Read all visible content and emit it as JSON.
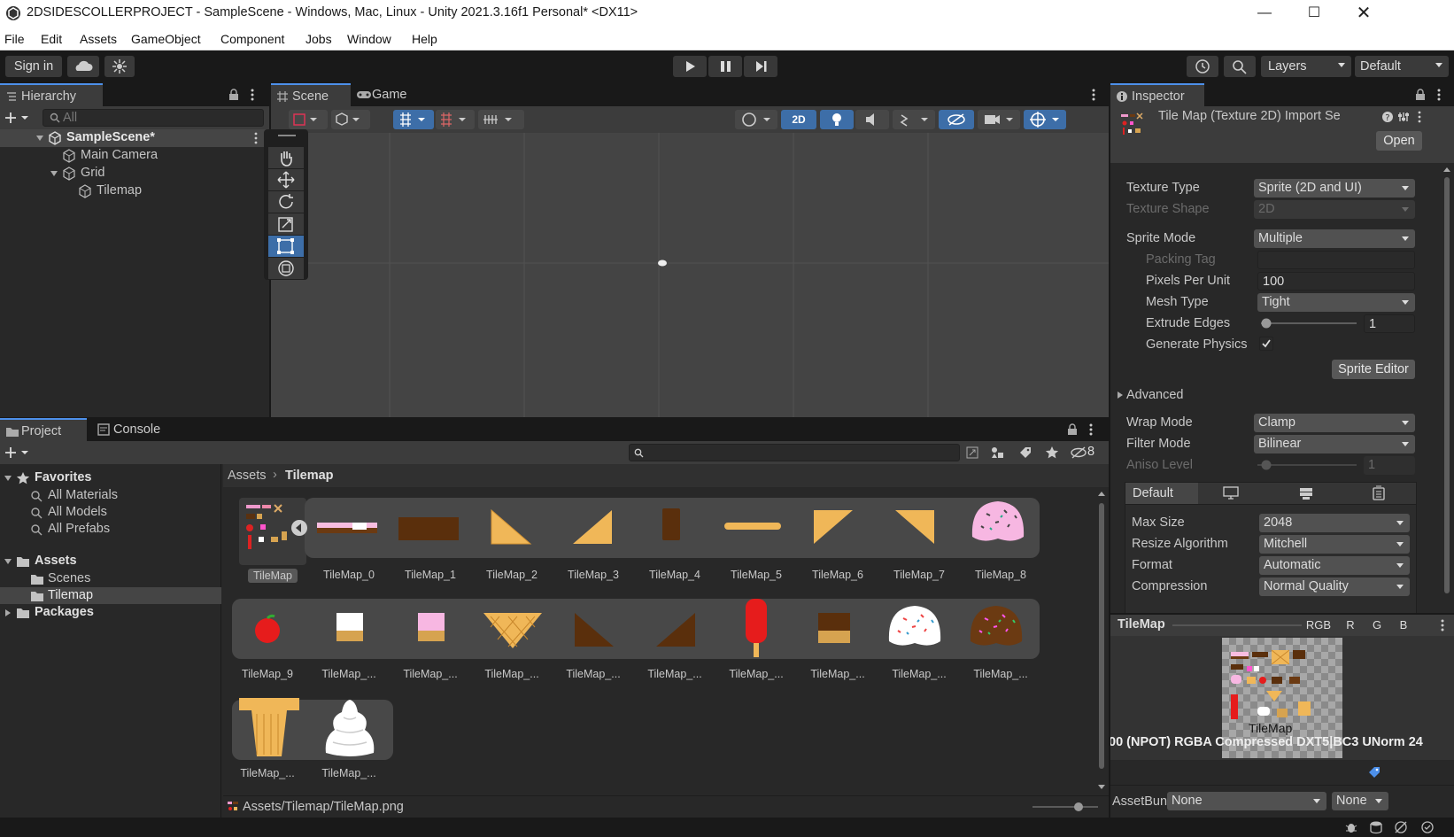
{
  "window": {
    "title": "2DSIDESCOLLERPROJECT - SampleScene - Windows, Mac, Linux - Unity 2021.3.16f1 Personal* <DX11>"
  },
  "menu": [
    "File",
    "Edit",
    "Assets",
    "GameObject",
    "Component",
    "Jobs",
    "Window",
    "Help"
  ],
  "toolbar": {
    "signin": "Sign in",
    "layers": "Layers",
    "layout": "Default"
  },
  "hierarchy": {
    "tab": "Hierarchy",
    "search_placeholder": "All",
    "scene": "SampleScene*",
    "items": [
      "Main Camera",
      "Grid",
      "Tilemap"
    ]
  },
  "scene_view": {
    "tab_scene": "Scene",
    "tab_game": "Game",
    "mode_2d": "2D"
  },
  "project": {
    "tab_project": "Project",
    "tab_console": "Console",
    "hidden_count": "8",
    "favorites": {
      "label": "Favorites",
      "items": [
        "All Materials",
        "All Models",
        "All Prefabs"
      ]
    },
    "assets": {
      "label": "Assets",
      "items": [
        "Scenes",
        "Tilemap"
      ]
    },
    "packages": "Packages",
    "breadcrumb": {
      "root": "Assets",
      "current": "Tilemap"
    },
    "parent_asset": "TileMap",
    "row1": [
      "TileMap_0",
      "TileMap_1",
      "TileMap_2",
      "TileMap_3",
      "TileMap_4",
      "TileMap_5",
      "TileMap_6",
      "TileMap_7",
      "TileMap_8"
    ],
    "row2": [
      "TileMap_9",
      "TileMap_...",
      "TileMap_...",
      "TileMap_...",
      "TileMap_...",
      "TileMap_...",
      "TileMap_...",
      "TileMap_...",
      "TileMap_...",
      "TileMap_..."
    ],
    "row3": [
      "TileMap_...",
      "TileMap_..."
    ],
    "status_path": "Assets/Tilemap/TileMap.png"
  },
  "inspector": {
    "tab": "Inspector",
    "title": "Tile Map (Texture 2D) Import Se",
    "open_button": "Open",
    "texture_type": {
      "label": "Texture Type",
      "value": "Sprite (2D and UI)"
    },
    "texture_shape": {
      "label": "Texture Shape",
      "value": "2D"
    },
    "sprite_mode": {
      "label": "Sprite Mode",
      "value": "Multiple"
    },
    "packing_tag": {
      "label": "Packing Tag",
      "value": ""
    },
    "pixels_per_unit": {
      "label": "Pixels Per Unit",
      "value": "100"
    },
    "mesh_type": {
      "label": "Mesh Type",
      "value": "Tight"
    },
    "extrude_edges": {
      "label": "Extrude Edges",
      "value": "1"
    },
    "generate_physics": {
      "label": "Generate Physics",
      "checked": true
    },
    "sprite_editor_button": "Sprite Editor",
    "advanced": "Advanced",
    "wrap_mode": {
      "label": "Wrap Mode",
      "value": "Clamp"
    },
    "filter_mode": {
      "label": "Filter Mode",
      "value": "Bilinear"
    },
    "aniso_level": {
      "label": "Aniso Level",
      "value": "1"
    },
    "platform_tab": "Default",
    "max_size": {
      "label": "Max Size",
      "value": "2048"
    },
    "resize_algorithm": {
      "label": "Resize Algorithm",
      "value": "Mitchell"
    },
    "format": {
      "label": "Format",
      "value": "Automatic"
    },
    "compression": {
      "label": "Compression",
      "value": "Normal Quality"
    },
    "preview": {
      "name": "TileMap",
      "channels": [
        "RGB",
        "R",
        "G",
        "B"
      ],
      "caption": "TileMap",
      "info": "00 (NPOT)  RGBA Compressed DXT5|BC3 UNorm  24"
    },
    "asset_bundle": {
      "label": "AssetBundle",
      "value": "None",
      "variant": "None"
    }
  },
  "colors": {
    "accent": "#4d90ea",
    "panel": "#282828",
    "background": "#191919",
    "selected": "#2c5d87"
  }
}
